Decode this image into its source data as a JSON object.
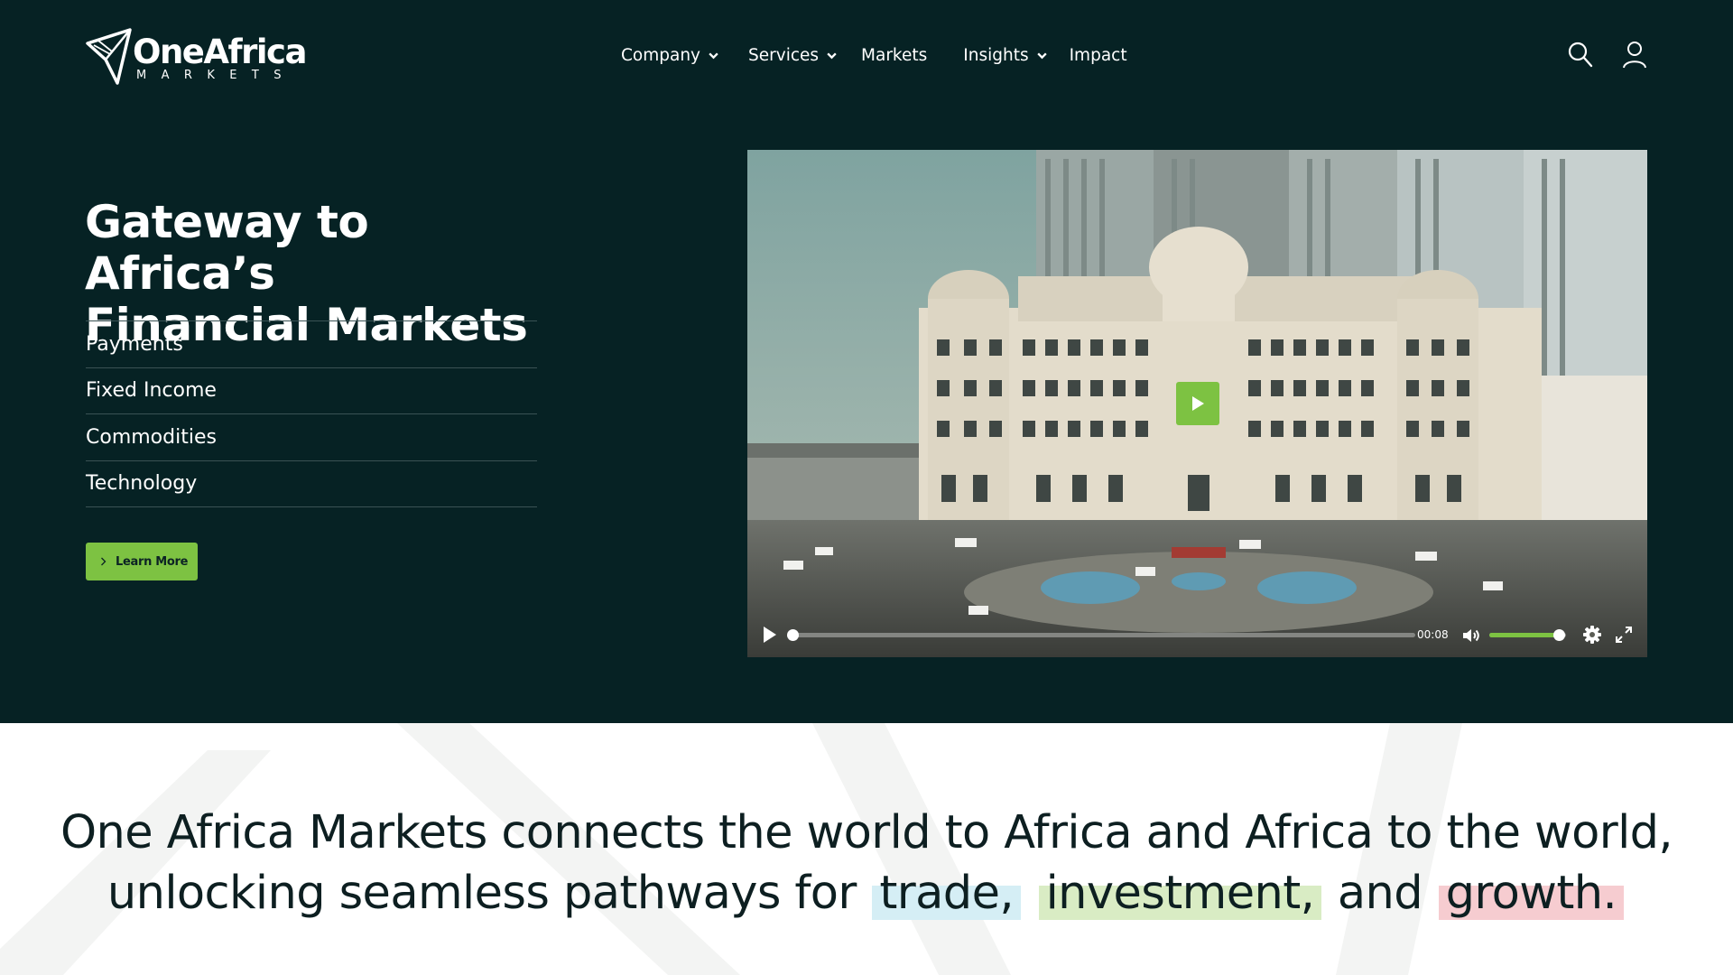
{
  "brand": {
    "name": "OneAfrica",
    "tagline": "MARKETS"
  },
  "nav": {
    "company": "Company",
    "services": "Services",
    "markets": "Markets",
    "insights": "Insights",
    "impact": "Impact"
  },
  "header_icons": {
    "search": "search-icon",
    "account": "user-icon"
  },
  "hero": {
    "title_line1": "Gateway to Africa’s",
    "title_line2": "Financial Markets",
    "services": [
      "Payments",
      "Fixed Income",
      "Commodities",
      "Technology"
    ],
    "cta": "Learn More"
  },
  "video": {
    "time": "00:08",
    "progress": 0.0,
    "volume": 0.9
  },
  "statement": {
    "line1": "One Africa Markets connects the world to Africa and Africa to the world,",
    "line2_prefix": "unlocking seamless pathways for",
    "word1": "trade,",
    "word2": "investment,",
    "conj": "and",
    "word3": "growth."
  },
  "colors": {
    "hero_bg": "#062224",
    "accent_green": "#7dc242",
    "highlight_trade": "#d5eef5",
    "highlight_investment": "#d9ecc4",
    "highlight_growth": "#f6ccd0"
  }
}
